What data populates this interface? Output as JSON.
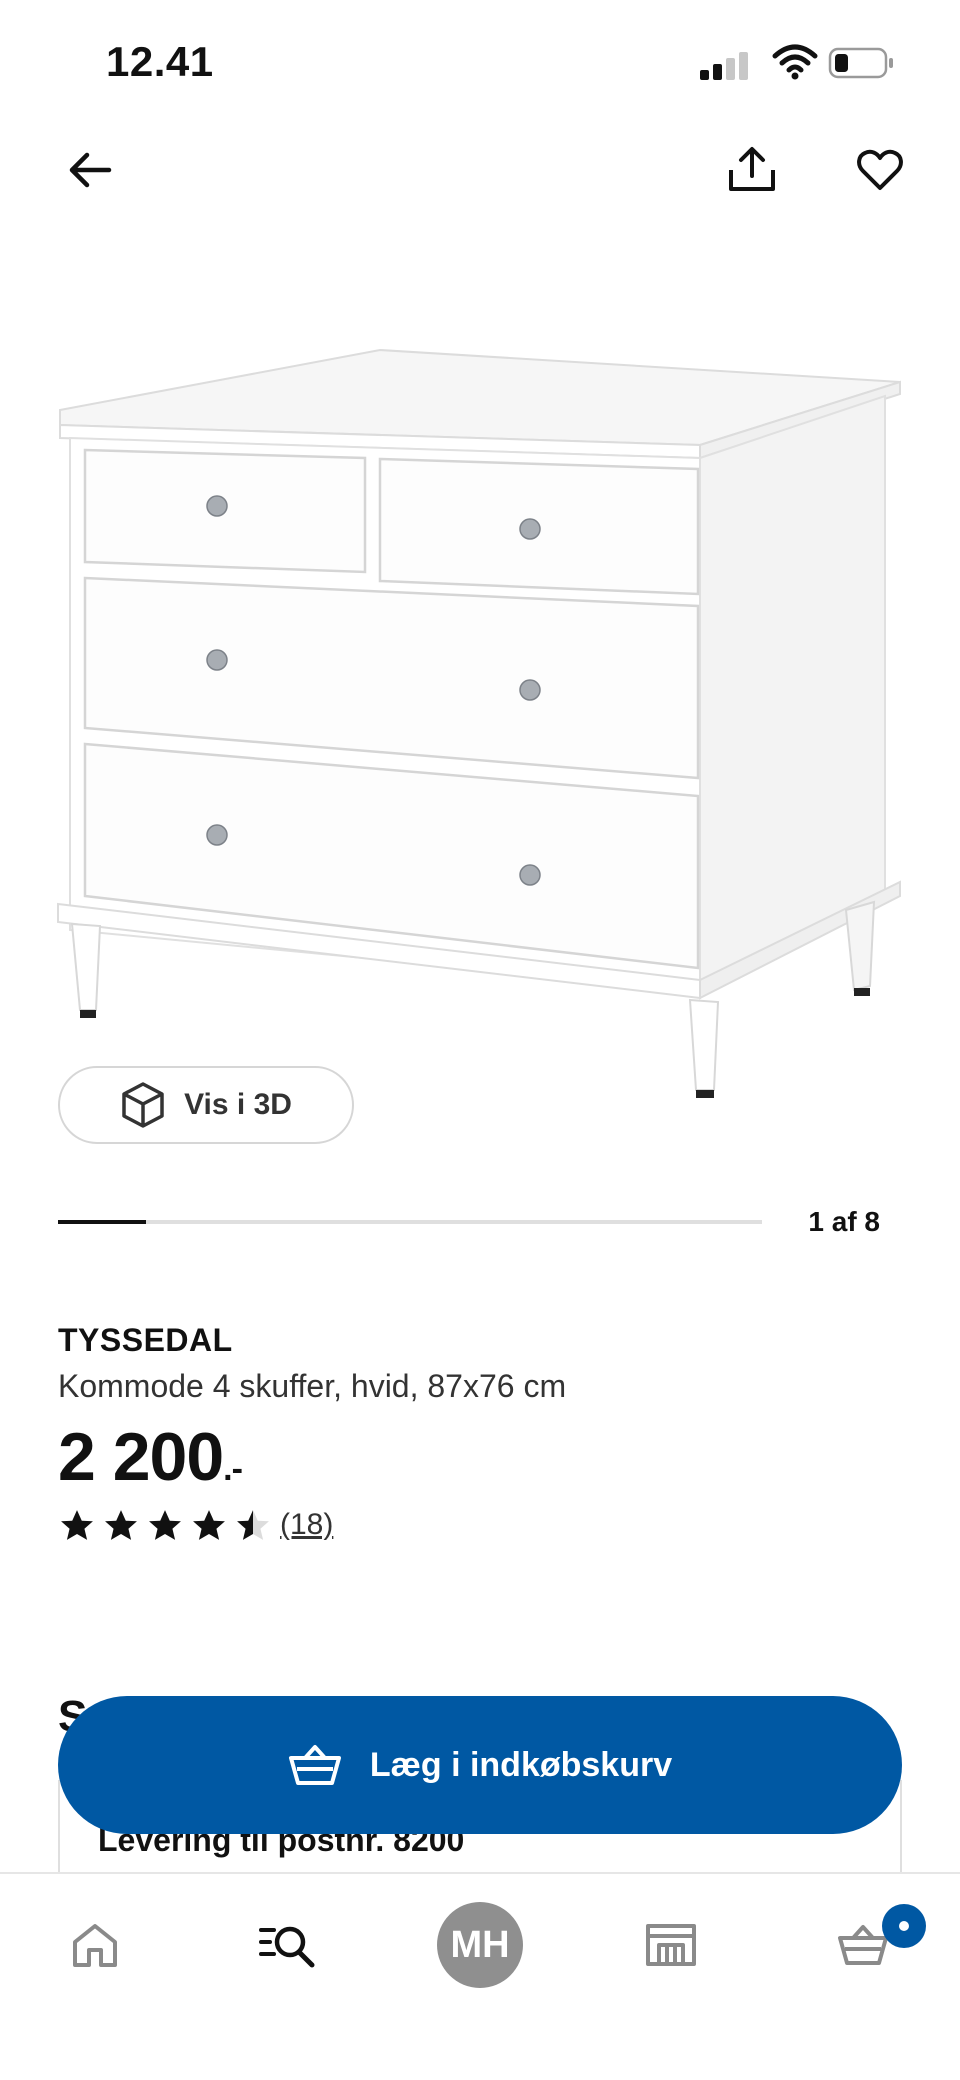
{
  "status_bar": {
    "time": "12.41"
  },
  "header": {
    "back_icon": "arrow-left-icon",
    "share_icon": "share-icon",
    "favorite_icon": "heart-icon"
  },
  "product": {
    "view_3d_label": "Vis i 3D",
    "carousel_counter": "1 af 8",
    "carousel_progress": 0.125,
    "brand": "TYSSEDAL",
    "description": "Kommode 4 skuffer, hvid, 87x76 cm",
    "price": "2 200",
    "price_suffix": ".-",
    "rating_value": 4.5,
    "rating_max": 5,
    "review_count": "(18)"
  },
  "section_peek": {
    "heading": "S",
    "delivery_text": "Levering til postnr. 8200"
  },
  "cta": {
    "add_to_cart_label": "Læg i indkøbskurv"
  },
  "tabbar": {
    "avatar_initials": "MH"
  },
  "colors": {
    "brand_blue": "#0058a3",
    "text": "#111111",
    "avatar_gray": "#8f8f8f"
  }
}
